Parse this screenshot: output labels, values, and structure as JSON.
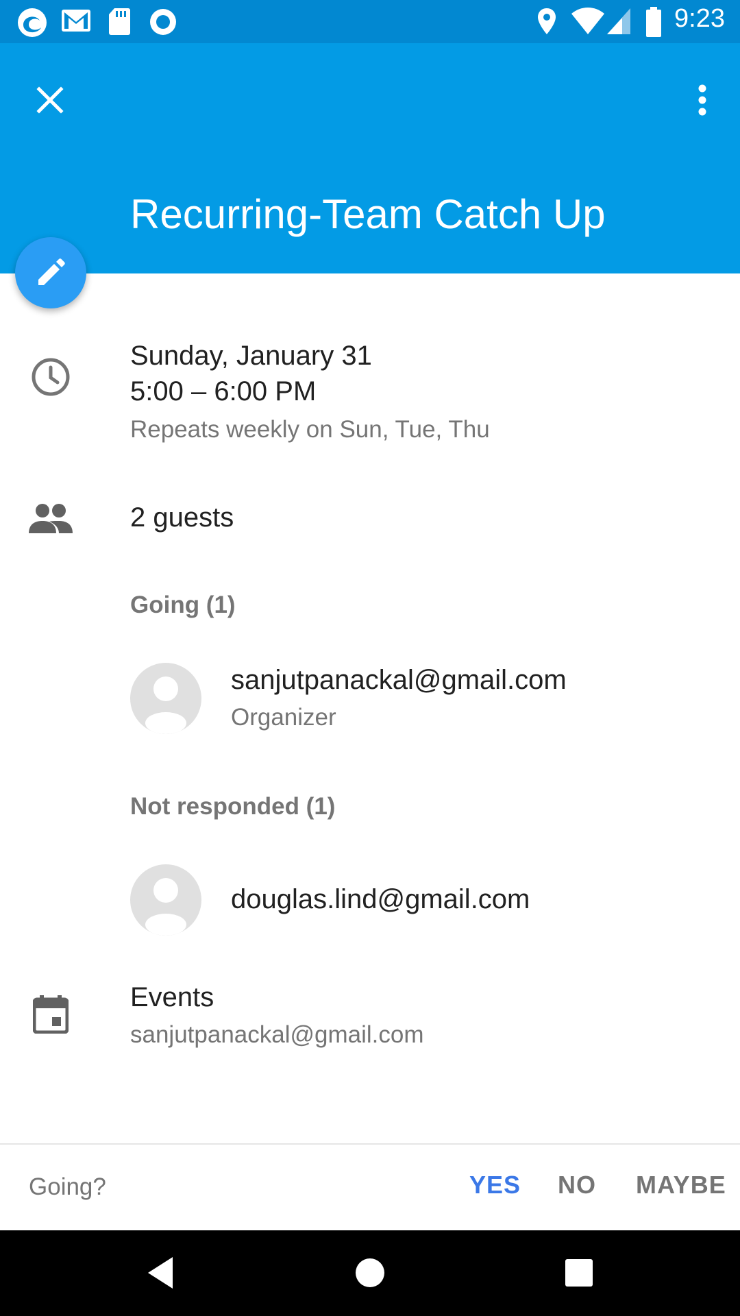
{
  "status_bar": {
    "time": "9:23",
    "left_icons": [
      "edge-browser-icon",
      "gmail-icon",
      "sd-card-icon",
      "record-icon"
    ],
    "right_icons": [
      "location-icon",
      "wifi-icon",
      "cell-signal-icon",
      "battery-icon"
    ]
  },
  "app_bar": {
    "title": "Recurring-Team Catch Up",
    "color": "#039be5"
  },
  "event": {
    "date": "Sunday, January 31",
    "time_range": "5:00 – 6:00 PM",
    "recurrence": "Repeats weekly on Sun, Tue, Thu"
  },
  "guests": {
    "count_label": "2 guests",
    "going_header": "Going (1)",
    "going": [
      {
        "email": "sanjutpanackal@gmail.com",
        "role": "Organizer"
      }
    ],
    "not_responded_header": "Not responded (1)",
    "not_responded": [
      {
        "email": "douglas.lind@gmail.com"
      }
    ]
  },
  "calendar": {
    "name": "Events",
    "account": "sanjutpanackal@gmail.com"
  },
  "rsvp": {
    "question": "Going?",
    "yes": "YES",
    "no": "NO",
    "maybe": "MAYBE",
    "accent": "#3b78e7"
  }
}
